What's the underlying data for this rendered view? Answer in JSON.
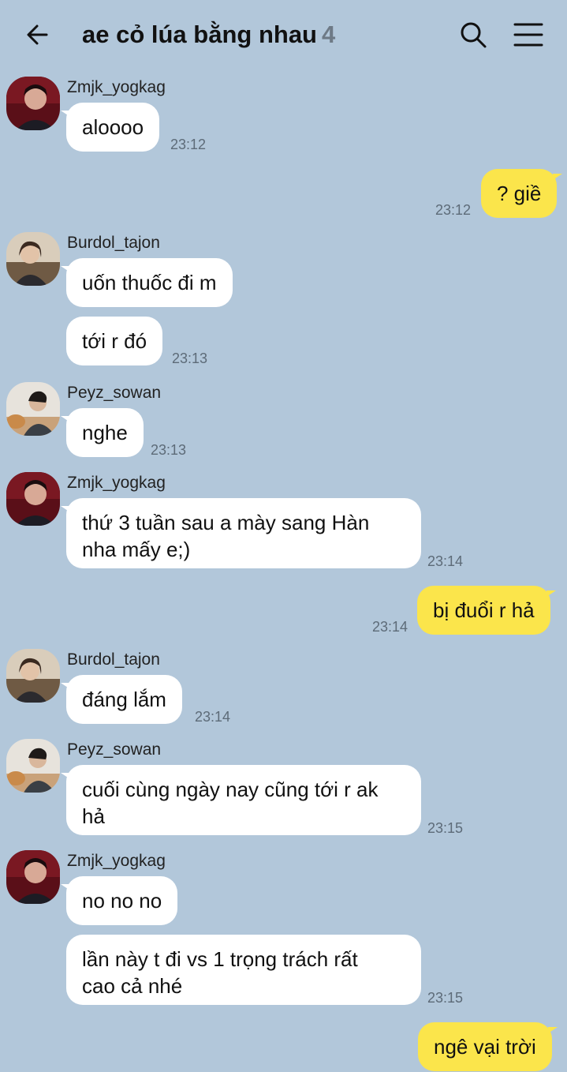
{
  "header": {
    "title": "ae cỏ lúa bằng nhau",
    "member_count": "4",
    "back_icon": "arrow-left-icon",
    "search_icon": "search-icon",
    "menu_icon": "hamburger-menu-icon"
  },
  "messages": [
    {
      "sender": "Zmjk_yogkag",
      "text": "aloooo",
      "time": "23:12"
    },
    {
      "text": "? giề",
      "time": "23:12"
    },
    {
      "sender": "Burdol_tajon",
      "text": "uốn thuốc đi m"
    },
    {
      "text": "tới r đó",
      "time": "23:13"
    },
    {
      "sender": "Peyz_sowan",
      "text": "nghe",
      "time": "23:13"
    },
    {
      "sender": "Zmjk_yogkag",
      "text": "thứ 3 tuần sau a mày sang Hàn\nnha mấy e;)",
      "time": "23:14"
    },
    {
      "text": "bị đuổi r hả",
      "time": "23:14"
    },
    {
      "sender": "Burdol_tajon",
      "text": "đáng lắm",
      "time": "23:14"
    },
    {
      "sender": "Peyz_sowan",
      "text": "cuối cùng ngày nay cũng tới r ak\nhả",
      "time": "23:15"
    },
    {
      "sender": "Zmjk_yogkag",
      "text": "no no no"
    },
    {
      "text": "lần này t đi vs 1 trọng trách rất\ncao cả nhé",
      "time": "23:15"
    },
    {
      "text": "ngê vại trời"
    }
  ],
  "colors": {
    "background": "#b2c7da",
    "my_bubble": "#fbe54b",
    "their_bubble": "#ffffff",
    "timestamp": "#5d6b78"
  }
}
